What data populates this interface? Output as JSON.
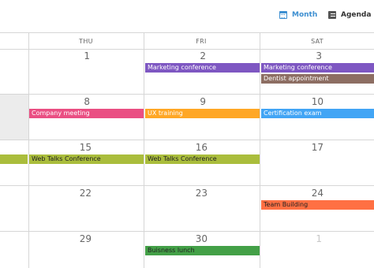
{
  "toolbar": {
    "month_label": "Month",
    "agenda_label": "Agenda"
  },
  "weekdays": [
    "THU",
    "FRI",
    "SAT"
  ],
  "weeks": [
    {
      "days": [
        "1",
        "2",
        "3"
      ]
    },
    {
      "days": [
        "8",
        "9",
        "10"
      ]
    },
    {
      "days": [
        "15",
        "16",
        "17"
      ]
    },
    {
      "days": [
        "22",
        "23",
        "24"
      ]
    },
    {
      "days": [
        "29",
        "30",
        "1"
      ]
    }
  ],
  "events": [
    {
      "title": "Marketing conference",
      "color": "#7e57c2",
      "text_color": "#ffffff"
    },
    {
      "title": "Marketing conference",
      "color": "#7e57c2",
      "text_color": "#ffffff"
    },
    {
      "title": "Dentist appointment",
      "color": "#8d6e63",
      "text_color": "#ffffff"
    },
    {
      "title": "Company meeting",
      "color": "#ea4f83",
      "text_color": "#ffffff"
    },
    {
      "title": "UX training",
      "color": "#ffa726",
      "text_color": "#ffffff"
    },
    {
      "title": "Certification exam",
      "color": "#42a5f5",
      "text_color": "#ffffff"
    },
    {
      "title": "",
      "color": "#aabd3c",
      "text_color": "#222222"
    },
    {
      "title": "Web Talks Conference",
      "color": "#aabd3c",
      "text_color": "#222222"
    },
    {
      "title": "Web Talks Conference",
      "color": "#aabd3c",
      "text_color": "#222222"
    },
    {
      "title": "Team Building",
      "color": "#ff7043",
      "text_color": "#222222"
    },
    {
      "title": "Buisness lunch",
      "color": "#43a047",
      "text_color": "#222222"
    }
  ]
}
